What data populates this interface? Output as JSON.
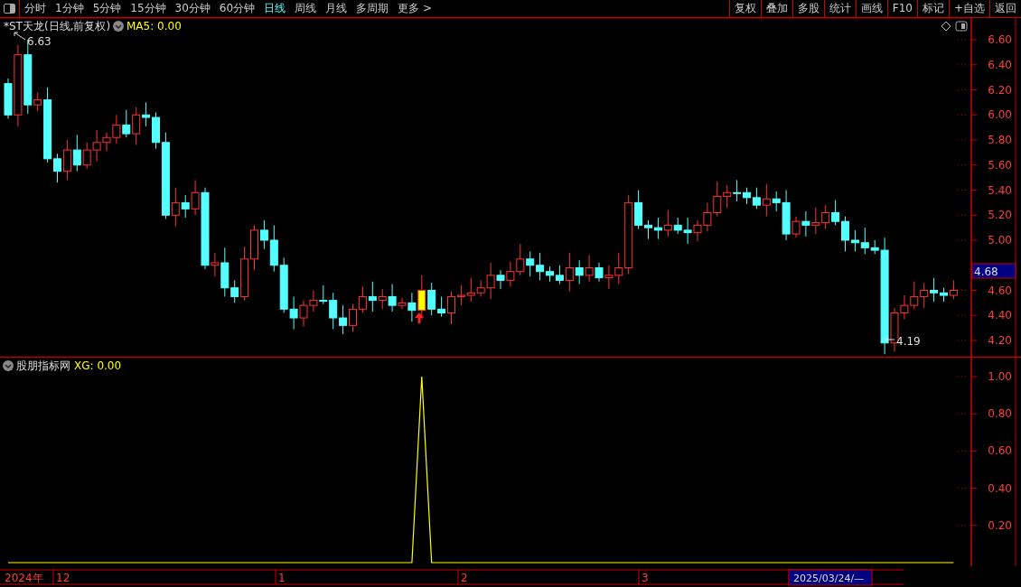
{
  "toolbar": {
    "periods": [
      {
        "label": "分时",
        "selected": false
      },
      {
        "label": "1分钟",
        "selected": false
      },
      {
        "label": "5分钟",
        "selected": false
      },
      {
        "label": "15分钟",
        "selected": false
      },
      {
        "label": "30分钟",
        "selected": false
      },
      {
        "label": "60分钟",
        "selected": false
      },
      {
        "label": "日线",
        "selected": true
      },
      {
        "label": "周线",
        "selected": false
      },
      {
        "label": "月线",
        "selected": false
      },
      {
        "label": "多周期",
        "selected": false
      },
      {
        "label": "更多 >",
        "selected": false
      }
    ],
    "actions": [
      "复权",
      "叠加",
      "多股",
      "统计",
      "画线",
      "F10",
      "标记",
      "+自选",
      "返回"
    ]
  },
  "main_chart": {
    "title": "*ST天龙(日线,前复权)",
    "indicator": "MA5: 0.00",
    "high_label": "6.63",
    "low_label": "4.19",
    "price_axis": [
      "6.60",
      "6.40",
      "6.20",
      "6.00",
      "5.80",
      "5.60",
      "5.40",
      "5.20",
      "5.00",
      "4.60",
      "4.40",
      "4.20"
    ],
    "current_price": "4.68"
  },
  "indicator_panel": {
    "title": "股朋指标网",
    "reading": "XG: 0.00",
    "value_axis": [
      "1.00",
      "0.80",
      "0.60",
      "0.40",
      "0.20"
    ]
  },
  "date_bar": {
    "year": "2024年",
    "months": [
      "12",
      "1",
      "2",
      "3"
    ],
    "cursor_date": "2025/03/24/—"
  }
}
